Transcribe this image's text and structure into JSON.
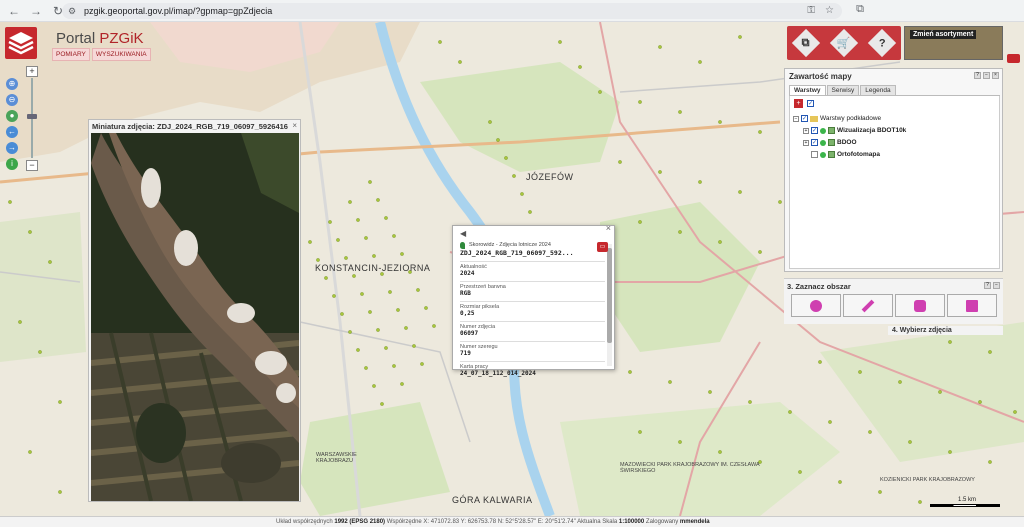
{
  "browser": {
    "url": "pzgik.geoportal.gov.pl/imap/?gpmap=gpZdjecia"
  },
  "header": {
    "title_prefix": "Portal ",
    "title_brand": "PZGiK",
    "tabs": [
      "POMIARY",
      "WYSZUKIWANIA"
    ]
  },
  "thumbnail": {
    "title": "Miniatura zdjęcia: ZDJ_2024_RGB_719_06097_5926416",
    "close": "×"
  },
  "popup": {
    "layer": "Skorowidz - Zdjęcia lotnicze 2024",
    "name": "ZDJ_2024_RGB_719_06097_592...",
    "fields": [
      {
        "label": "Aktualność",
        "value": "2024"
      },
      {
        "label": "Przestrzeń barwna",
        "value": "RGB"
      },
      {
        "label": "Rozmiar piksela",
        "value": "0,25"
      },
      {
        "label": "Numer zdjęcia",
        "value": "06097"
      },
      {
        "label": "Numer szeregu",
        "value": "719"
      },
      {
        "label": "Karta pracy",
        "value": "24_07_18_112_014_2024"
      }
    ]
  },
  "toolbar_right": {
    "asort_label": "Zmień asortyment"
  },
  "map_content": {
    "title": "Zawartość mapy",
    "tabs": [
      "Warstwy",
      "Serwisy",
      "Legenda"
    ],
    "tree": {
      "group": "Warstwy podkładowe",
      "layers": [
        "Wizualizacja BDOT10k",
        "BDOO",
        "Ortofotomapa"
      ]
    }
  },
  "section3": {
    "title": "3. Zaznacz obszar"
  },
  "section4": {
    "title": "4. Wybierz zdjęcia"
  },
  "map_labels": {
    "jozefow": "JÓZEFÓW",
    "konstancin": "KONSTANCIN-JEZIORNA",
    "gora_kalwaria": "GÓRA KALWARIA",
    "mazowiecki": "MAZOWIECKI PARK KRAJOBRAZOWY IM. CZESŁAWA ŚWIRSKIEGO",
    "kozienicki": "KOZIENICKI PARK KRAJOBRAZOWY",
    "warszawa_krolewska": "WARSZAWSKIE KRAJOBRAZU"
  },
  "status": {
    "coord_system_label": "Układ współrzędnych ",
    "coord_system": "1992 (EPSG 2180)",
    "coords_label": " Współrzędne X: ",
    "x": "471072.83",
    "y_label": " Y: ",
    "y": "626753.78",
    "lat_label": " N: ",
    "lat": "52°5'28.57\"",
    "lon_label": " E: ",
    "lon": "20°51'2.74\"",
    "scale_label": " Aktualna Skala ",
    "scale": "1:100000",
    "user_label": " Zalogowany ",
    "user": "mmendela"
  },
  "scalebar": {
    "label": "1.5 km"
  }
}
